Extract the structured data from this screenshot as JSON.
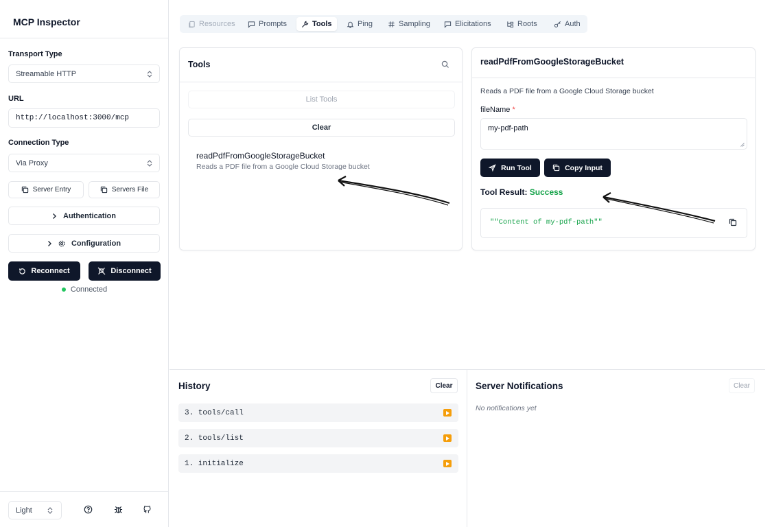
{
  "app": {
    "title": "MCP Inspector"
  },
  "sidebar": {
    "transport_label": "Transport Type",
    "transport_value": "Streamable HTTP",
    "url_label": "URL",
    "url_value": "http://localhost:3000/mcp",
    "connection_label": "Connection Type",
    "connection_value": "Via Proxy",
    "server_entry": "Server Entry",
    "servers_file": "Servers File",
    "authentication": "Authentication",
    "configuration": "Configuration",
    "reconnect": "Reconnect",
    "disconnect": "Disconnect",
    "status": "Connected",
    "theme": "Light"
  },
  "tabs": [
    "Resources",
    "Prompts",
    "Tools",
    "Ping",
    "Sampling",
    "Elicitations",
    "Roots",
    "Auth"
  ],
  "tools_panel": {
    "title": "Tools",
    "list_tools": "List Tools",
    "clear": "Clear",
    "tool_name": "readPdfFromGoogleStorageBucket",
    "tool_desc": "Reads a PDF file from a Google Cloud Storage bucket"
  },
  "detail_panel": {
    "title": "readPdfFromGoogleStorageBucket",
    "desc": "Reads a PDF file from a Google Cloud Storage bucket",
    "field_label": "fileName",
    "required_mark": "*",
    "field_value": "my-pdf-path",
    "run_tool": "Run Tool",
    "copy_input": "Copy Input",
    "result_label": "Tool Result:",
    "result_status": "Success",
    "result_value": "\"\"Content of my-pdf-path\"\""
  },
  "history": {
    "title": "History",
    "clear": "Clear",
    "items": [
      "3. tools/call",
      "2. tools/list",
      "1. initialize"
    ]
  },
  "notifications": {
    "title": "Server Notifications",
    "clear": "Clear",
    "empty": "No notifications yet"
  },
  "colors": {
    "accent_dark": "#0f172a",
    "success": "#16a34a",
    "status_dot": "#22c55e",
    "play": "#f59e0b"
  }
}
